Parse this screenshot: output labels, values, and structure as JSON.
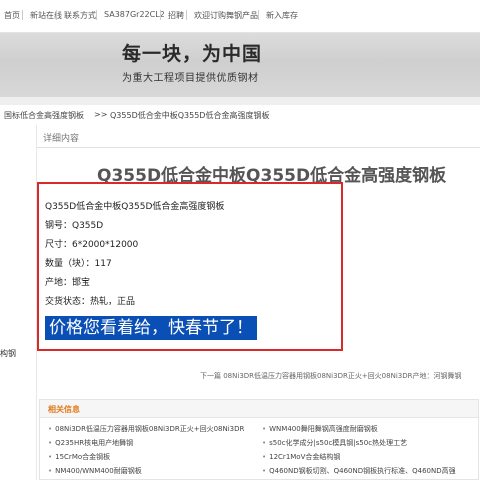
{
  "nav": {
    "items": [
      "首页",
      "新站在线",
      "联系方式",
      "SA387Gr22CL2",
      "招聘",
      "欢迎订购舞钢产品",
      "新入库存"
    ]
  },
  "banner": {
    "slogan": "每一块，为中国",
    "subslogan": "为重大工程项目提供优质钢材"
  },
  "breadcrumb": {
    "parent": "国标低合金高强度钢板",
    "separator": ">>",
    "current": "Q355D低合金中板Q355D低合金高强度钢板"
  },
  "sidebar": {
    "text": "构钢"
  },
  "main": {
    "tab_label": "详细内容",
    "title": "Q355D低合金中板Q355D低合金高强度钢板",
    "info": {
      "line1": "Q355D低合金中板Q355D低合金高强度钢板",
      "line2": "钢号：Q355D",
      "line3": "尺寸：6*2000*12000",
      "line4": "数量（块）：117",
      "line5": "产地：邯宝",
      "line6": "交货状态：热轧，正品"
    },
    "highlight": "价格您看着给，快春节了！",
    "next_line": "下一篇    08Ni3DR低温压力容器用钢板08Ni3DR正火+回火08Ni3DR产地：河钢舞钢"
  },
  "related": {
    "title": "相关信息",
    "items": [
      "08Ni3DR低温压力容器用钢板08Ni3DR正火+回火08Ni3DR",
      "WNM400舞阳舞钢高强度耐磨钢板",
      "Q235HR核电用产地舞钢",
      "s50c化学成分|s50c模具钢|s50c热处理工艺",
      "15CrMo合金钢板",
      "12Cr1MoV合金结构钢",
      "NM400/WNM400耐磨钢板",
      "Q460ND钢板切割、Q460ND钢板执行标准、Q460ND高强"
    ]
  }
}
